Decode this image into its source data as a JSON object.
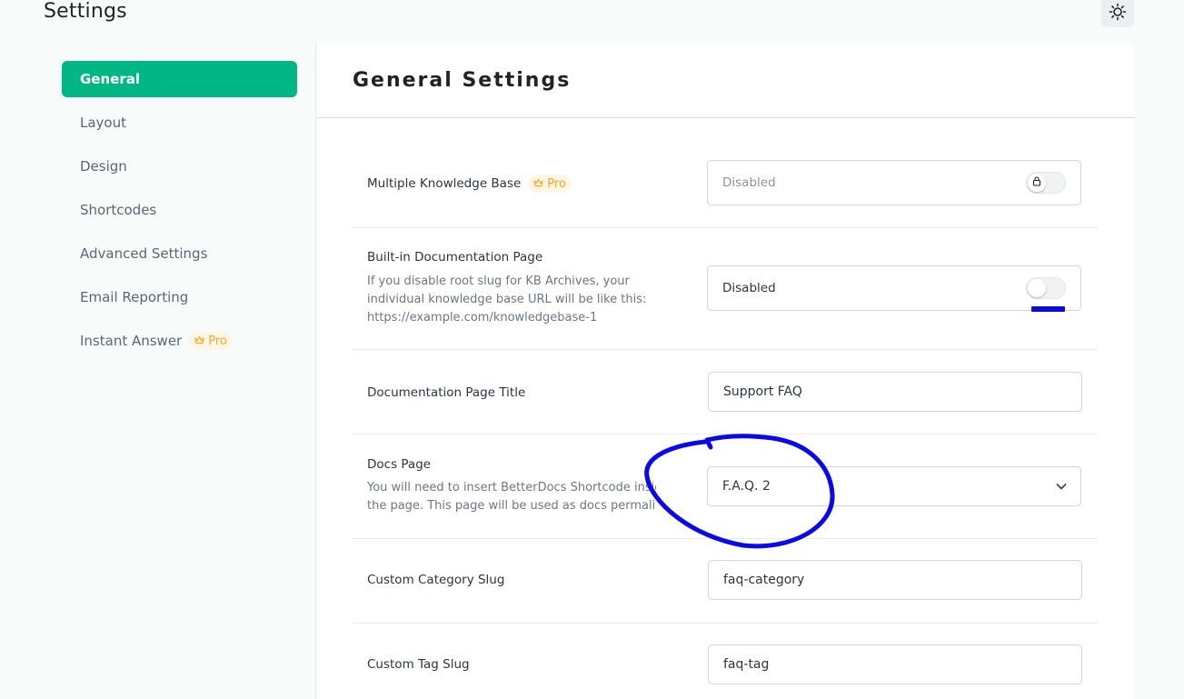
{
  "page": {
    "title": "Settings",
    "theme_toggle_icon": "sun-icon"
  },
  "sidebar": {
    "items": [
      {
        "label": "General",
        "active": true
      },
      {
        "label": "Layout"
      },
      {
        "label": "Design"
      },
      {
        "label": "Shortcodes"
      },
      {
        "label": "Advanced Settings"
      },
      {
        "label": "Email Reporting"
      },
      {
        "label": "Instant Answer",
        "badge": "Pro"
      }
    ],
    "active_color": "#00b682"
  },
  "main": {
    "title": "General Settings",
    "rows": [
      {
        "label": "Multiple Knowledge Base",
        "badge": "Pro",
        "control": "locked-toggle",
        "value": "Disabled"
      },
      {
        "label": "Built-in Documentation Page",
        "description": "If you disable root slug for KB Archives, your individual knowledge base URL will be like this: https://example.com/knowledgebase-1",
        "description_lines": [
          "If you disable root slug for KB Archives, your",
          "individual knowledge base URL will be like this:",
          "https://example.com/knowledgebase-1"
        ],
        "control": "toggle",
        "value": "Disabled"
      },
      {
        "label": "Documentation Page Title",
        "control": "text",
        "value": "Support FAQ"
      },
      {
        "label": "Docs Page",
        "description_lines": [
          "You will need to insert BetterDocs Shortcode insid",
          "the page. This page will be used as docs permalink."
        ],
        "control": "select",
        "value": "F.A.Q. 2"
      },
      {
        "label": "Custom Category Slug",
        "control": "text",
        "value": "faq-category"
      },
      {
        "label": "Custom Tag Slug",
        "control": "text",
        "value": "faq-tag"
      }
    ]
  },
  "colors": {
    "pro_badge": "#f5a623",
    "annotation": "#0a0ae8"
  }
}
